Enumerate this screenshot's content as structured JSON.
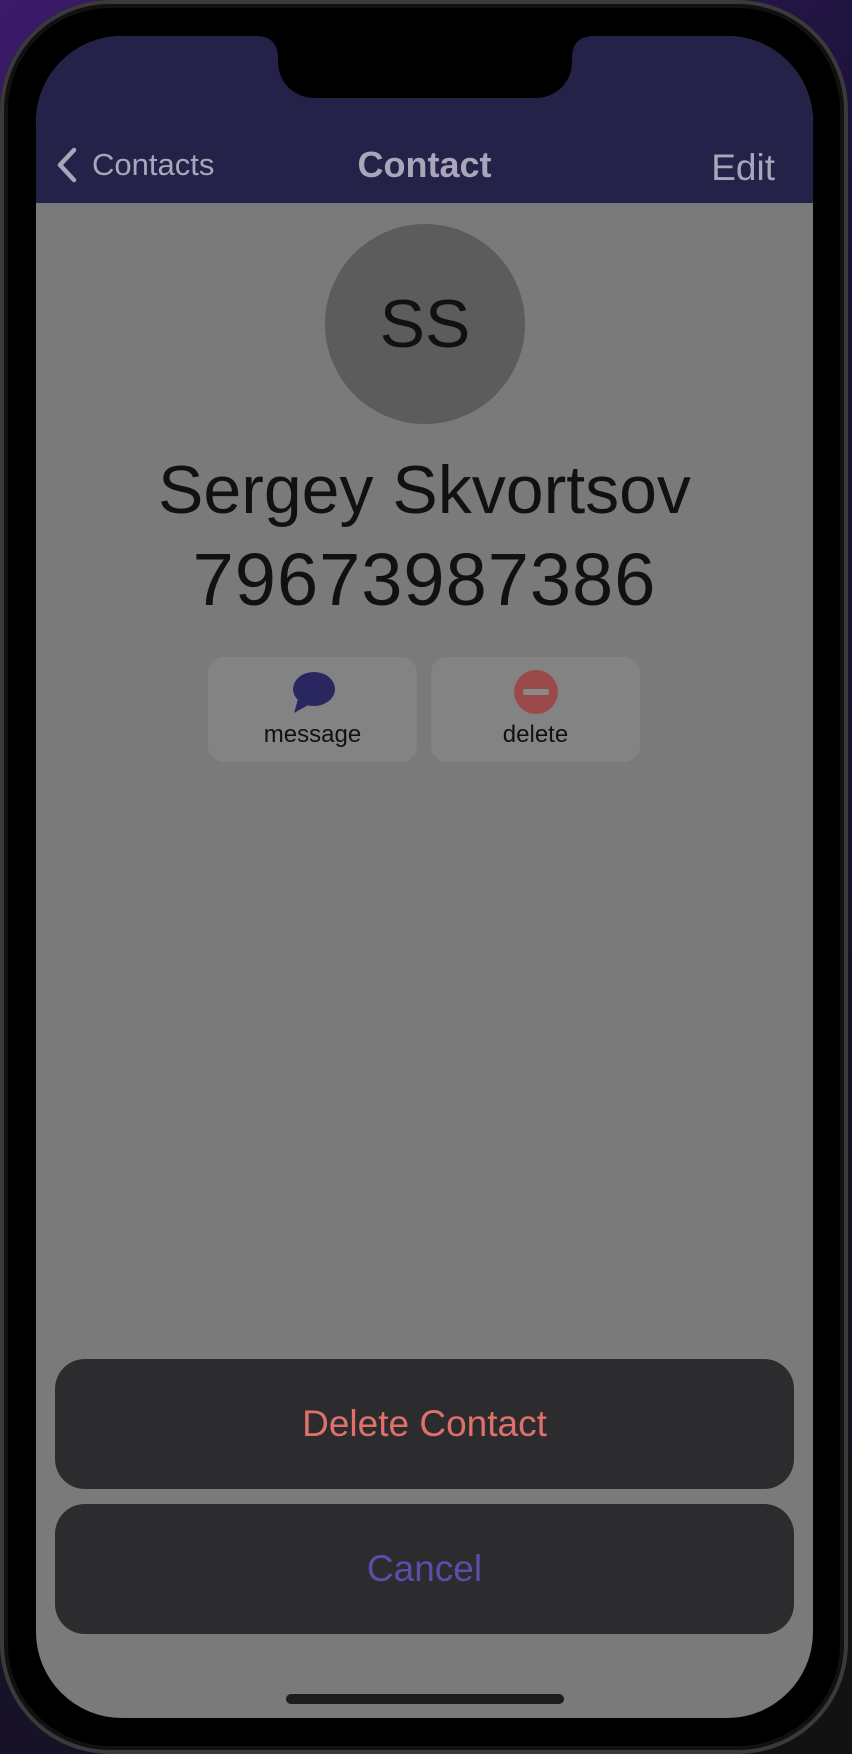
{
  "navbar": {
    "back_label": "Contacts",
    "title": "Contact",
    "edit_label": "Edit"
  },
  "contact": {
    "initials": "SS",
    "name": "Sergey Skvortsov",
    "phone": "79673987386"
  },
  "actions": {
    "message_label": "message",
    "delete_label": "delete",
    "message_icon": "speech-bubble-icon",
    "delete_icon": "minus-circle-icon"
  },
  "action_sheet": {
    "delete_label": "Delete Contact",
    "cancel_label": "Cancel"
  },
  "colors": {
    "navbar_bg": "#25224a",
    "accent": "#2a2660",
    "destructive": "#e0706a",
    "delete_icon": "#9a4a48",
    "cancel_text": "#5a4ea8"
  }
}
